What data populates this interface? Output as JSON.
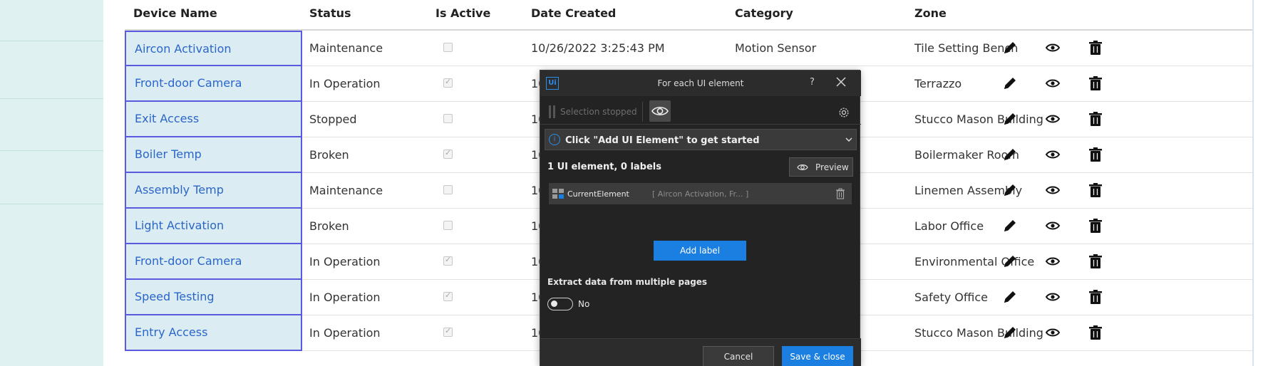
{
  "table": {
    "headers": [
      "Device Name",
      "Status",
      "Is Active",
      "Date Created",
      "Category",
      "Zone"
    ],
    "rows": [
      {
        "name": "Aircon Activation",
        "status": "Maintenance",
        "active": false,
        "date": "10/26/2022 3:25:43 PM",
        "category": "Motion Sensor",
        "zone": "Tile Setting Bench"
      },
      {
        "name": "Front-door Camera",
        "status": "In Operation",
        "active": true,
        "date": "10",
        "category": "",
        "zone": "Terrazzo"
      },
      {
        "name": "Exit Access",
        "status": "Stopped",
        "active": false,
        "date": "10",
        "category": "",
        "zone": "Stucco Mason Building"
      },
      {
        "name": "Boiler Temp",
        "status": "Broken",
        "active": true,
        "date": "10",
        "category": "",
        "zone": "Boilermaker Room"
      },
      {
        "name": "Assembly Temp",
        "status": "Maintenance",
        "active": false,
        "date": "10",
        "category": "",
        "zone": "Linemen Assembly"
      },
      {
        "name": "Light Activation",
        "status": "Broken",
        "active": false,
        "date": "10",
        "category": "",
        "zone": "Labor Office"
      },
      {
        "name": "Front-door Camera",
        "status": "In Operation",
        "active": true,
        "date": "10",
        "category": "",
        "zone": "Environmental Office"
      },
      {
        "name": "Speed Testing",
        "status": "In Operation",
        "active": true,
        "date": "10",
        "category": "",
        "zone": "Safety Office"
      },
      {
        "name": "Entry Access",
        "status": "In Operation",
        "active": true,
        "date": "10",
        "category": "",
        "zone": "Stucco Mason Building"
      }
    ],
    "actions": [
      "edit-icon",
      "view-icon",
      "delete-icon"
    ]
  },
  "dialog": {
    "logo": "Ui",
    "title": "For each UI element",
    "help": "?",
    "selection_status": "Selection stopped",
    "info_message": "Click \"Add UI Element\" to get started",
    "info_icon": "i",
    "element_count": "1 UI element, 0 labels",
    "preview_label": "Preview",
    "element_name": "CurrentElement",
    "element_description": "[ Aircon Activation, Fr... ]",
    "add_label": "Add label",
    "extract_label": "Extract data from multiple pages",
    "toggle_label": "No",
    "toggle_on": false,
    "cancel_label": "Cancel",
    "save_label": "Save & close"
  },
  "colors": {
    "link": "#2a66c8",
    "selection_border": "#5a5ae0",
    "selection_fill": "#dcecf3",
    "primary_button": "#1a7fe0",
    "dialog_bg": "#232323",
    "left_panel": "#dff1f1"
  }
}
